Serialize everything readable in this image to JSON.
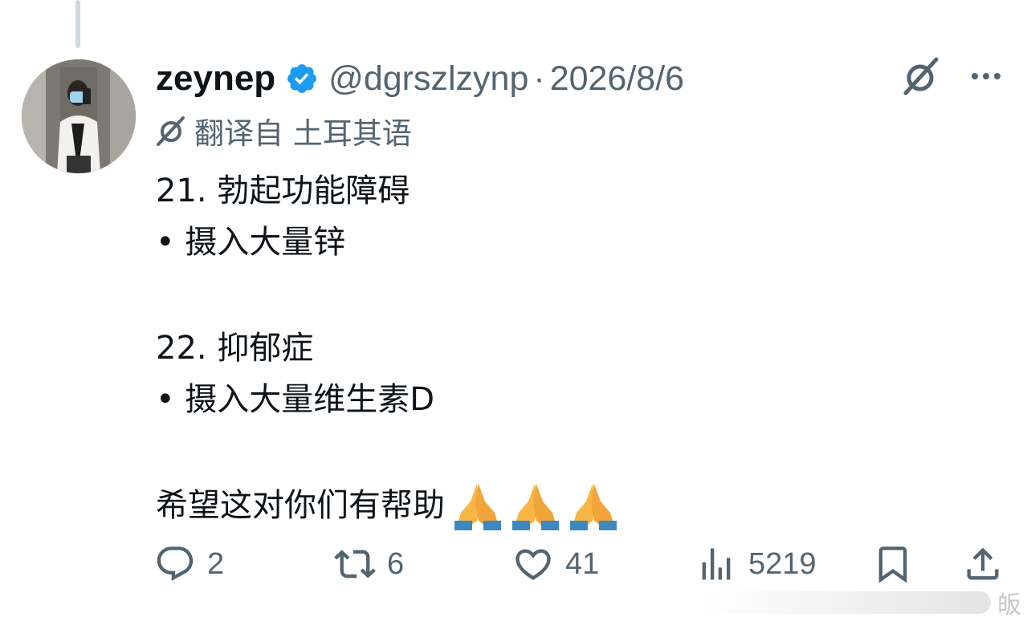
{
  "author": {
    "name": "zeynep",
    "handle": "@dgrszlzynp",
    "separator": "·",
    "date": "2026/8/6",
    "verified": true,
    "verified_color": "#1d9bf0"
  },
  "translation_label": "翻译自 土耳其语",
  "content": {
    "lines": [
      "21. 勃起功能障碍",
      "• 摄入大量锌",
      "22. 抑郁症",
      "• 摄入大量维生素D",
      "希望这对你们有帮助"
    ],
    "emoji_name": "folded-hands-emoji",
    "emoji_count": 3
  },
  "actions": {
    "replies": "2",
    "reposts": "6",
    "likes": "41",
    "views": "5219"
  },
  "watermark": "皈",
  "colors": {
    "text": "#0f1419",
    "secondary": "#536471",
    "accent": "#1d9bf0"
  }
}
